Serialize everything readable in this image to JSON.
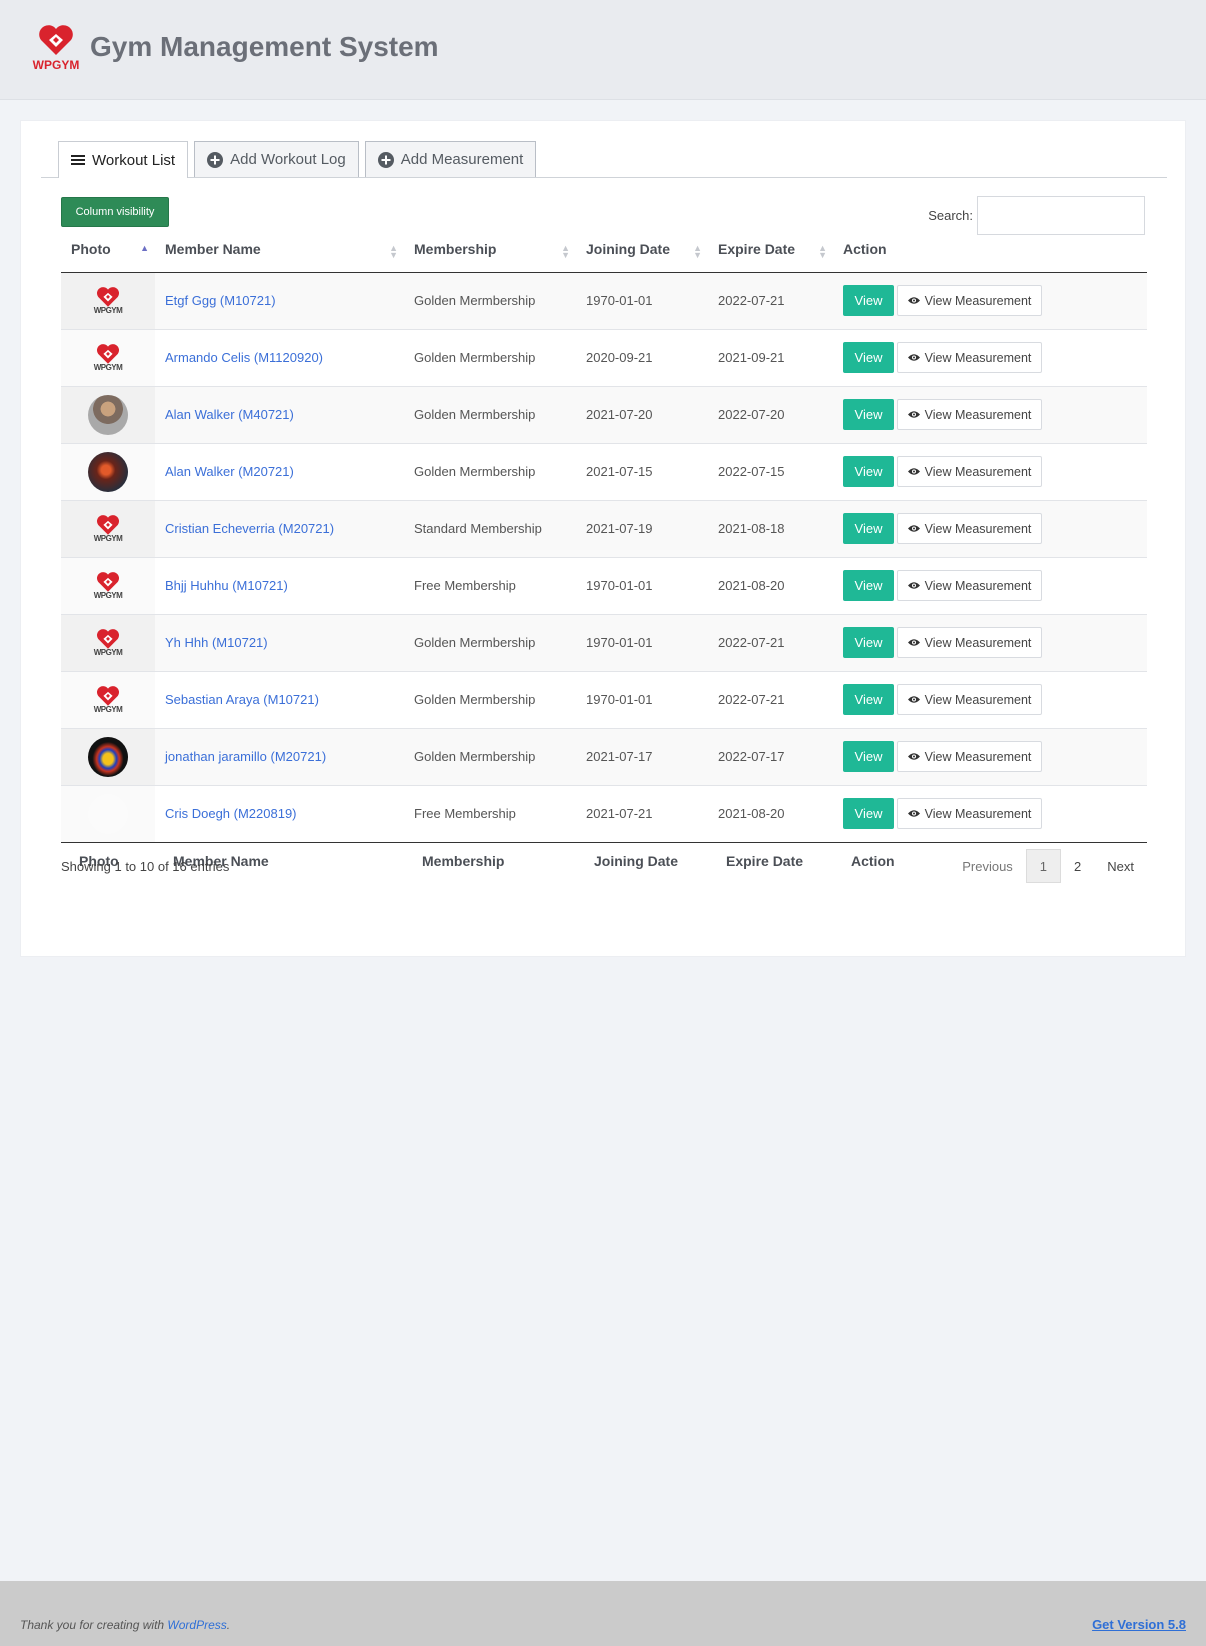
{
  "header": {
    "logo_text": "WPGYM",
    "title": "Gym Management System",
    "brand_color": "#d9232d"
  },
  "tabs": [
    {
      "label": "Workout List",
      "icon": "list-icon",
      "active": true
    },
    {
      "label": "Add Workout Log",
      "icon": "plus-circle-icon",
      "active": false
    },
    {
      "label": "Add Measurement",
      "icon": "plus-circle-icon",
      "active": false
    }
  ],
  "toolbar": {
    "column_visibility_label": "Column visibility",
    "search_label": "Search:",
    "search_value": ""
  },
  "table": {
    "columns": [
      "Photo",
      "Member Name",
      "Membership",
      "Joining Date",
      "Expire Date",
      "Action"
    ],
    "sorted_column": "Photo",
    "view_label": "View",
    "measurement_label": "View Measurement",
    "rows": [
      {
        "photo": "wpgym-logo",
        "name": "Etgf Ggg (M10721)",
        "membership": "Golden Mermbership",
        "joining": "1970-01-01",
        "expire": "2022-07-21"
      },
      {
        "photo": "wpgym-logo",
        "name": "Armando Celis (M1120920)",
        "membership": "Golden Mermbership",
        "joining": "2020-09-21",
        "expire": "2021-09-21"
      },
      {
        "photo": "avatar-1",
        "name": "Alan Walker (M40721)",
        "membership": "Golden Mermbership",
        "joining": "2021-07-20",
        "expire": "2022-07-20"
      },
      {
        "photo": "avatar-2",
        "name": "Alan Walker (M20721)",
        "membership": "Golden Mermbership",
        "joining": "2021-07-15",
        "expire": "2022-07-15"
      },
      {
        "photo": "wpgym-logo",
        "name": "Cristian Echeverria (M20721)",
        "membership": "Standard Membership",
        "joining": "2021-07-19",
        "expire": "2021-08-18"
      },
      {
        "photo": "wpgym-logo",
        "name": "Bhjj Huhhu (M10721)",
        "membership": "Free Membership",
        "joining": "1970-01-01",
        "expire": "2021-08-20"
      },
      {
        "photo": "wpgym-logo",
        "name": "Yh Hhh (M10721)",
        "membership": "Golden Mermbership",
        "joining": "1970-01-01",
        "expire": "2022-07-21"
      },
      {
        "photo": "wpgym-logo",
        "name": "Sebastian Araya (M10721)",
        "membership": "Golden Mermbership",
        "joining": "1970-01-01",
        "expire": "2022-07-21"
      },
      {
        "photo": "avatar-3",
        "name": "jonathan jaramillo (M20721)",
        "membership": "Golden Mermbership",
        "joining": "2021-07-17",
        "expire": "2022-07-17"
      },
      {
        "photo": "avatar-4",
        "name": "Cris Doegh (M220819)",
        "membership": "Free Membership",
        "joining": "2021-07-21",
        "expire": "2021-08-20"
      }
    ]
  },
  "table_info": "Showing 1 to 10 of 16 entries",
  "pagination": {
    "previous": "Previous",
    "pages": [
      "1",
      "2"
    ],
    "current": "1",
    "next": "Next"
  },
  "footer": {
    "thanks_prefix": "Thank you for creating with ",
    "thanks_link": "WordPress",
    "thanks_suffix": ".",
    "version": "Get Version 5.8"
  },
  "colors": {
    "view_button": "#1fb896",
    "column_visibility_button": "#2e8b57",
    "link": "#3b6fd8"
  }
}
